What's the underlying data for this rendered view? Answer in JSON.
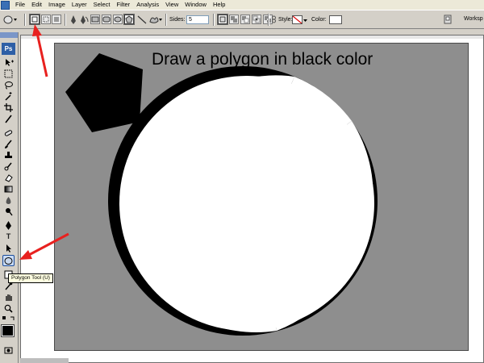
{
  "menu": {
    "items": [
      "File",
      "Edit",
      "Image",
      "Layer",
      "Select",
      "Filter",
      "Analysis",
      "View",
      "Window",
      "Help"
    ]
  },
  "options": {
    "sides_label": "Sides:",
    "sides_value": "5",
    "style_label": "Style:",
    "color_label": "Color:",
    "workspace_label": "Worksp"
  },
  "toolbox": {
    "badge": "Ps",
    "type_tool_glyph": "T",
    "tooltip": "Polygon Tool (U)"
  },
  "canvas": {
    "instruction": "Draw a polygon in black color",
    "background_color": "#8e8e8e",
    "polygon_color": "#000000"
  },
  "accent": {
    "arrow_color": "#e8211f"
  }
}
